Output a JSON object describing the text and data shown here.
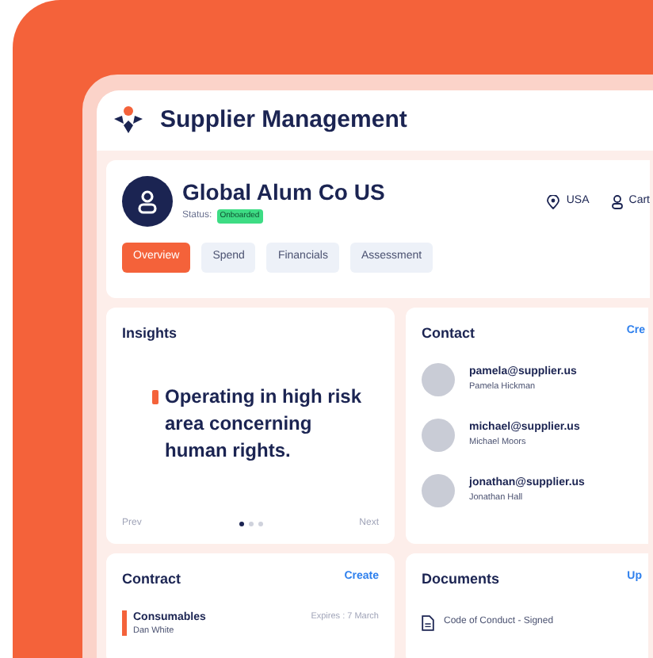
{
  "app": {
    "title": "Supplier Management"
  },
  "supplier": {
    "name": "Global Alum Co US",
    "status_label": "Status:",
    "status": "Onboarded",
    "location": "USA",
    "owner": "Cart"
  },
  "tabs": [
    {
      "label": "Overview",
      "selected": true
    },
    {
      "label": "Spend",
      "selected": false
    },
    {
      "label": "Financials",
      "selected": false
    },
    {
      "label": "Assessment",
      "selected": false
    }
  ],
  "insights": {
    "title": "Insights",
    "text": "Operating in high risk area concerning human rights.",
    "prev": "Prev",
    "next": "Next",
    "pages": [
      {
        "selected": true
      },
      {
        "selected": false
      },
      {
        "selected": false
      }
    ]
  },
  "contact": {
    "title": "Contact",
    "action": "Cre",
    "people": [
      {
        "email": "pamela@supplier.us",
        "name": "Pamela Hickman"
      },
      {
        "email": "michael@supplier.us",
        "name": "Michael Moors"
      },
      {
        "email": "jonathan@supplier.us",
        "name": "Jonathan Hall"
      }
    ]
  },
  "contract": {
    "title": "Contract",
    "action": "Create",
    "items": [
      {
        "title": "Consumables",
        "person": "Dan White",
        "expiry": "Expires : 7 March"
      }
    ]
  },
  "documents": {
    "title": "Documents",
    "action": "Up",
    "items": [
      {
        "title": "Code of Conduct - Signed"
      }
    ]
  }
}
